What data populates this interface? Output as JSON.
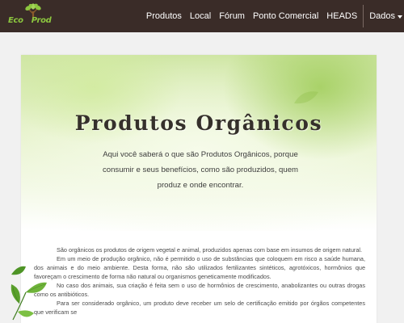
{
  "brand": {
    "left": "Eco",
    "right": "Prod"
  },
  "nav": {
    "items": [
      "Produtos",
      "Local",
      "Fórum",
      "Ponto Comercial",
      "HEADS"
    ],
    "dropdown_label": "Dados"
  },
  "hero": {
    "title": "Produtos Orgânicos",
    "subtitle": "Aqui você saberá o que são Produtos Orgânicos, porque consumir e seus benefícios, como são produzidos, quem produz e onde encontrar."
  },
  "content": {
    "paragraphs": [
      "São orgânicos os produtos de origem vegetal e animal, produzidos apenas com base em insumos de origem natural.",
      "Em um meio de produção orgânico, não é permitido o uso de substâncias que coloquem em risco a saúde humana, dos animais e do meio ambiente. Desta forma, não são utilizados fertilizantes sintéticos, agrotóxicos, hormônios que favoreçam o crescimento de forma não natural ou organismos geneticamente modificados.",
      "No caso dos animais, sua criação é feita sem o uso de hormônios de crescimento, anabolizantes ou outras drogas como os antibióticos.",
      "Para ser considerado orgânico, um produto deve receber um selo de certificação emitido por órgãos competentes que verificam se"
    ]
  },
  "colors": {
    "navbar_bg": "#3a2c28",
    "brand_green": "#8cc63f",
    "page_bg": "#f1f1f1"
  }
}
